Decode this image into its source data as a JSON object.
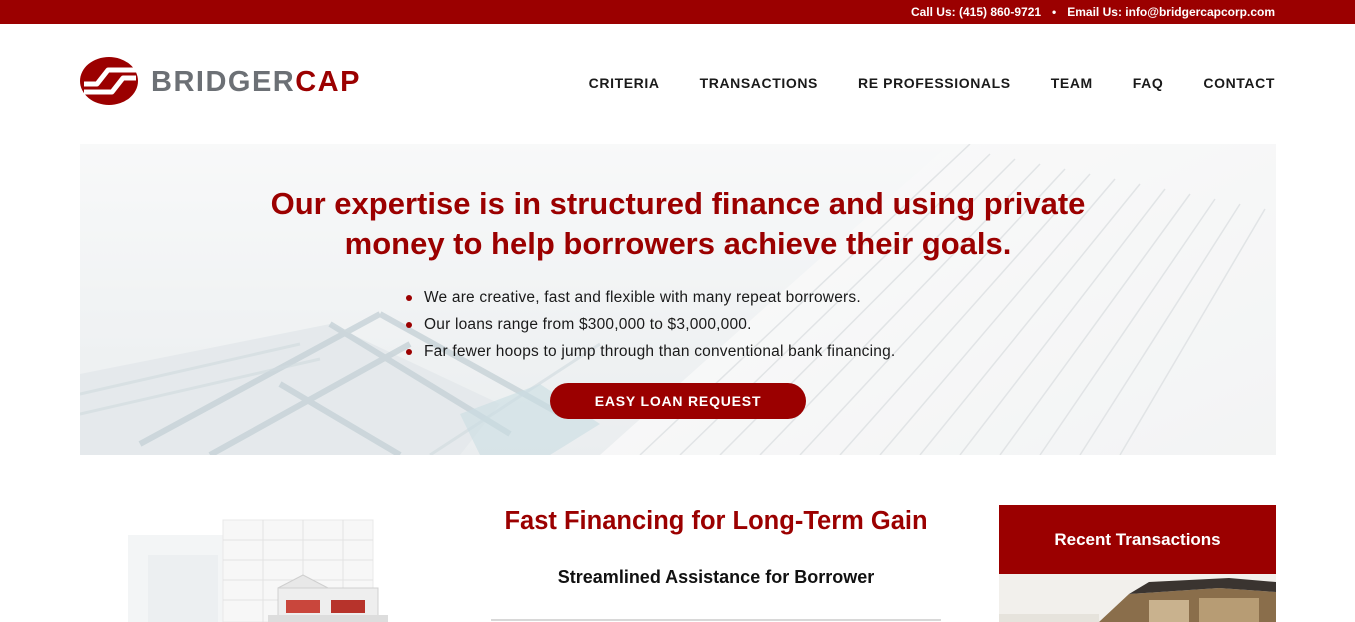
{
  "topbar": {
    "call": "Call Us: (415) 860-9721",
    "separator": "•",
    "email": "Email Us: info@bridgercapcorp.com"
  },
  "logo": {
    "word_part1": "BRIDGER",
    "word_part2": "CAP",
    "icon": "bridgercap-logo-mark"
  },
  "nav": {
    "items": [
      "CRITERIA",
      "TRANSACTIONS",
      "RE PROFESSIONALS",
      "TEAM",
      "FAQ",
      "CONTACT"
    ]
  },
  "hero": {
    "headline_line1": "Our expertise is in structured finance and using private",
    "headline_line2": "money to help borrowers achieve their goals.",
    "bullets": [
      "We are creative, fast and flexible with many repeat borrowers.",
      "Our loans range from $300,000 to $3,000,000.",
      "Far fewer hoops to jump through than conventional bank financing."
    ],
    "cta_label": "EASY LOAN REQUEST"
  },
  "main": {
    "title": "Fast Financing for Long-Term Gain",
    "subtitle": "Streamlined Assistance for Borrower"
  },
  "sidebar": {
    "recent_title": "Recent Transactions"
  },
  "colors": {
    "brand": "#9b0000",
    "logo_gray": "#6c7075",
    "text": "#1a1a1a"
  }
}
